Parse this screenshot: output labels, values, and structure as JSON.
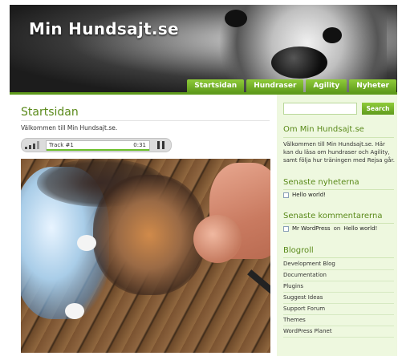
{
  "header": {
    "site_title": "Min Hundsajt.se"
  },
  "nav": {
    "tabs": [
      "Startsidan",
      "Hundraser",
      "Agility",
      "Nyheter"
    ]
  },
  "main": {
    "title": "Startsidan",
    "intro": "Välkommen till Min Hundsajt.se.",
    "player": {
      "track": "Track #1",
      "time": "0:31"
    }
  },
  "sidebar": {
    "search_button": "Search",
    "about": {
      "heading": "Om Min Hundsajt.se",
      "text": "Välkommen till Min Hundsajt.se. Här kan du läsa om hundraser och Agility, samt följa hur träningen med Rejsa går."
    },
    "news": {
      "heading": "Senaste nyheterna",
      "item": "Hello world!"
    },
    "comments": {
      "heading": "Senaste kommentarerna",
      "author": "Mr WordPress",
      "on": "on",
      "post": "Hello world!"
    },
    "blogroll": {
      "heading": "Blogroll",
      "items": [
        "Development Blog",
        "Documentation",
        "Plugins",
        "Suggest Ideas",
        "Support Forum",
        "Themes",
        "WordPress Planet"
      ]
    }
  }
}
